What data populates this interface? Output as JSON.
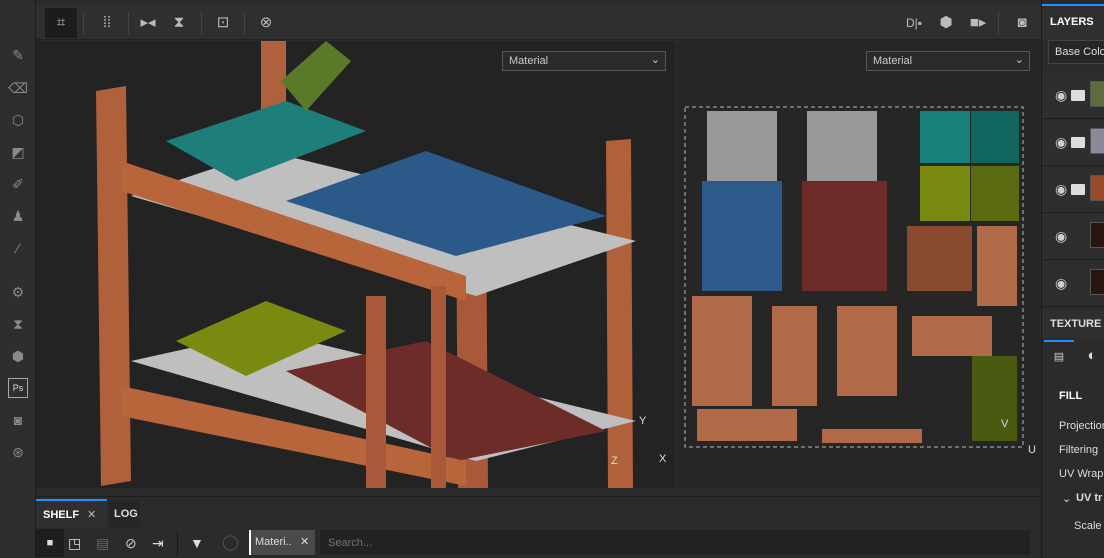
{
  "toolbar": {
    "tools": [
      "select-tool",
      "grid-options",
      "mirror-x",
      "mirror-y",
      "center-tool",
      "reset-tool"
    ],
    "right_tools": [
      "display-mode",
      "render-mode",
      "camera",
      "screenshot"
    ]
  },
  "viewport3d": {
    "dropdown": "Material",
    "axis": {
      "y": "Y",
      "x": "X",
      "z": "Z"
    }
  },
  "viewport2d": {
    "dropdown": "Material",
    "axis": {
      "v": "V",
      "u": "U"
    }
  },
  "layers": {
    "title": "LAYERS",
    "channel": "Base Color",
    "items": [
      {
        "type": "folder",
        "thumb": "#5d6b3d"
      },
      {
        "type": "folder",
        "thumb": "#8a8a9a"
      },
      {
        "type": "folder-open",
        "thumb": "#9a4b2a"
      },
      {
        "type": "fill",
        "thumb": "#2a140e"
      },
      {
        "type": "fill",
        "thumb": "#2a140e"
      }
    ]
  },
  "texture_set": {
    "title": "TEXTURE S",
    "section": "FILL",
    "props": [
      "Projection",
      "Filtering",
      "UV Wrap"
    ],
    "group": "UV tr",
    "sub": "Scale"
  },
  "shelf": {
    "tabs": [
      "SHELF",
      "LOG"
    ],
    "filter_chip": "Materi..",
    "search_placeholder": "Search..."
  }
}
